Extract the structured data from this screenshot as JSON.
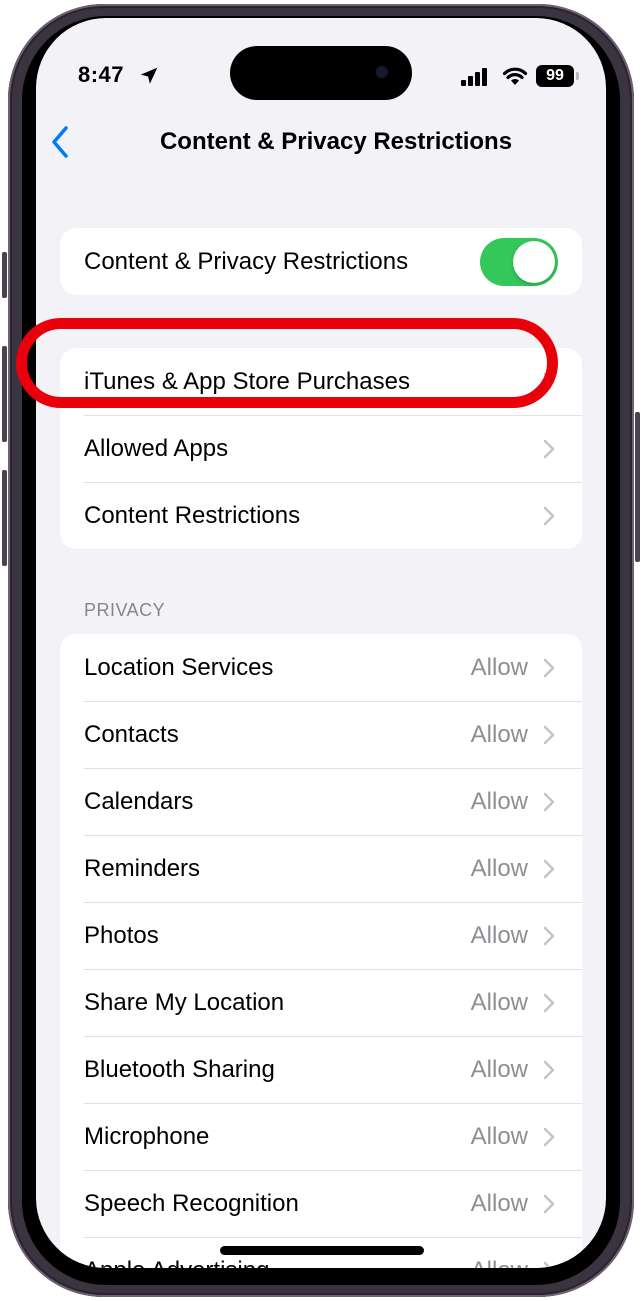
{
  "status_bar": {
    "time": "8:47",
    "location_icon": "location-arrow-icon",
    "signal_icon": "cellular-signal-icon",
    "wifi_icon": "wifi-icon",
    "battery_level": "99"
  },
  "nav": {
    "back_icon": "chevron-left-icon",
    "title": "Content & Privacy Restrictions"
  },
  "master_toggle": {
    "label": "Content & Privacy Restrictions",
    "enabled": true,
    "on_color": "#34c759"
  },
  "restrictions_group": {
    "items": [
      {
        "label": "iTunes & App Store Purchases",
        "highlighted": true
      },
      {
        "label": "Allowed Apps"
      },
      {
        "label": "Content Restrictions"
      }
    ]
  },
  "privacy_section": {
    "header": "PRIVACY",
    "items": [
      {
        "label": "Location Services",
        "value": "Allow"
      },
      {
        "label": "Contacts",
        "value": "Allow"
      },
      {
        "label": "Calendars",
        "value": "Allow"
      },
      {
        "label": "Reminders",
        "value": "Allow"
      },
      {
        "label": "Photos",
        "value": "Allow"
      },
      {
        "label": "Share My Location",
        "value": "Allow"
      },
      {
        "label": "Bluetooth Sharing",
        "value": "Allow"
      },
      {
        "label": "Microphone",
        "value": "Allow"
      },
      {
        "label": "Speech Recognition",
        "value": "Allow"
      },
      {
        "label": "Apple Advertising",
        "value": "Allow"
      }
    ]
  },
  "annotation": {
    "highlight_color": "#e8000a",
    "target": "iTunes & App Store Purchases"
  },
  "colors": {
    "accent": "#007aff",
    "background": "#f2f2f7",
    "secondary_text": "#8e8e93"
  }
}
